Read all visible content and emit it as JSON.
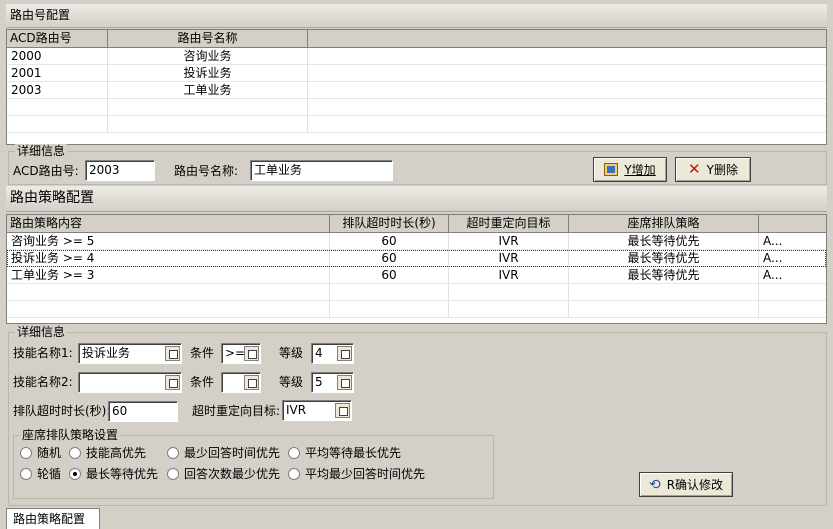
{
  "route_section": {
    "title": "路由号配置",
    "columns": [
      "ACD路由号",
      "路由号名称"
    ],
    "rows": [
      [
        "2000",
        "咨询业务"
      ],
      [
        "2001",
        "投诉业务"
      ],
      [
        "2003",
        "工单业务"
      ]
    ]
  },
  "route_detail": {
    "legend": "详细信息",
    "acd_label": "ACD路由号:",
    "acd_value": "2003",
    "name_label": "路由号名称:",
    "name_value": "工单业务",
    "add_label": "Y增加",
    "delete_label": "Y删除"
  },
  "strategy_section": {
    "title": "路由策略配置",
    "columns": [
      "路由策略内容",
      "排队超时时长(秒)",
      "超时重定向目标",
      "座席排队策略",
      ""
    ],
    "rows": [
      [
        "咨询业务 >= 5",
        "60",
        "IVR",
        "最长等待优先",
        "A..."
      ],
      [
        "投诉业务 >= 4",
        "60",
        "IVR",
        "最长等待优先",
        "A..."
      ],
      [
        "工单业务 >= 3",
        "60",
        "IVR",
        "最长等待优先",
        "A..."
      ]
    ]
  },
  "strategy_detail": {
    "legend": "详细信息",
    "skill1_label": "技能名称1:",
    "skill1_value": "投诉业务",
    "cond_label": "条件",
    "cond1_value": ">=",
    "level_label": "等级",
    "level1_value": "4",
    "skill2_label": "技能名称2:",
    "skill2_value": "",
    "cond2_value": "",
    "level2_value": "5",
    "timeout_label": "排队超时时长(秒):",
    "timeout_value": "60",
    "redirect_label": "超时重定向目标:",
    "redirect_value": "IVR",
    "confirm_label": "R确认修改"
  },
  "queue_policy": {
    "legend": "座席排队策略设置",
    "options": [
      "随机",
      "技能高优先",
      "最少回答时间优先",
      "平均等待最长优先",
      "轮循",
      "最长等待优先",
      "回答次数最少优先",
      "平均最少回答时间优先"
    ],
    "selected": "最长等待优先"
  },
  "bottom_tab": {
    "label": "路由策略配置"
  },
  "colors": {
    "bg": "#d4d0c8",
    "grid_bg": "#ffffff",
    "header_grad": "#ecebe6"
  }
}
